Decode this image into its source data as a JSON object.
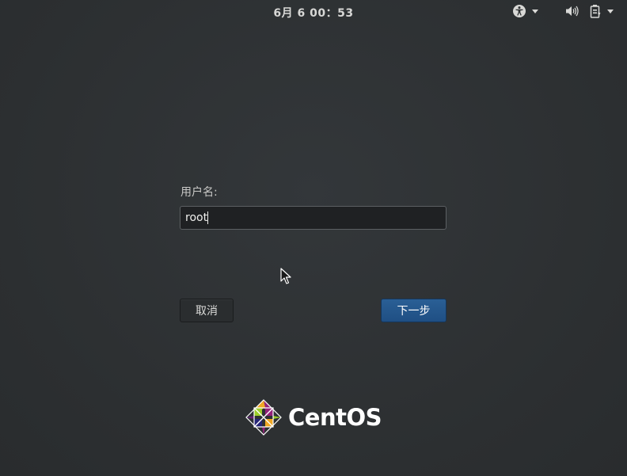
{
  "topbar": {
    "clock": "6月 6 00：53",
    "icons": [
      "accessibility-icon",
      "volume-icon",
      "power-battery-icon"
    ]
  },
  "login": {
    "username_label": "用户名:",
    "username_value": "root",
    "cancel_label": "取消",
    "next_label": "下一步"
  },
  "branding": {
    "logo_text": "CentOS"
  },
  "colors": {
    "background": "#2e3133",
    "accent": "#215d9c",
    "text": "#eeeeec"
  }
}
